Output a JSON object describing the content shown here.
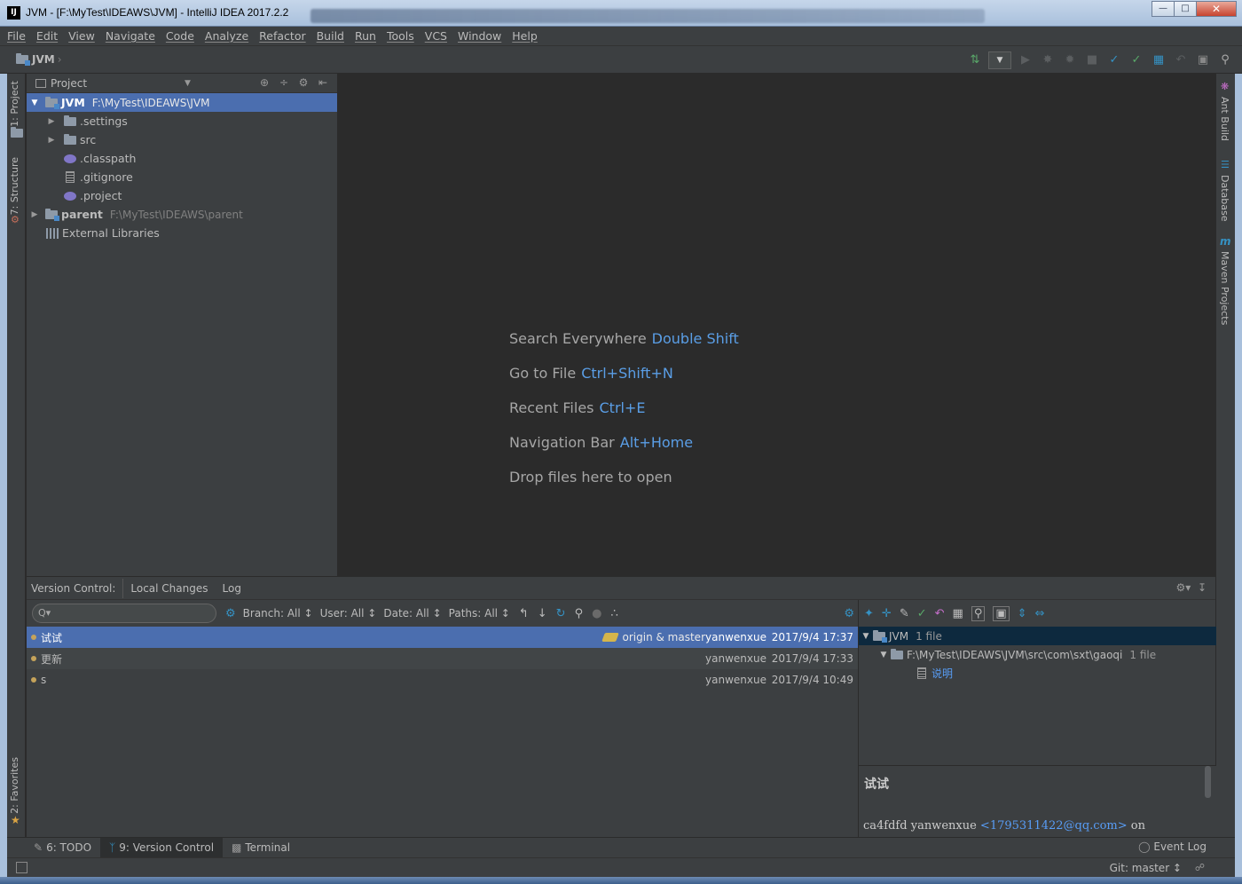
{
  "window": {
    "title": "JVM - [F:\\MyTest\\IDEAWS\\JVM] - IntelliJ IDEA 2017.2.2",
    "app_icon": "IJ",
    "controls": [
      "minimize",
      "maximize",
      "close"
    ]
  },
  "menu": [
    "File",
    "Edit",
    "View",
    "Navigate",
    "Code",
    "Analyze",
    "Refactor",
    "Build",
    "Run",
    "Tools",
    "VCS",
    "Window",
    "Help"
  ],
  "navbar": {
    "breadcrumb": "JVM"
  },
  "left_strip": {
    "tabs": [
      "1: Project",
      "7: Structure",
      "2: Favorites"
    ]
  },
  "right_strip": {
    "tabs": [
      "Ant Build",
      "Database",
      "Maven Projects"
    ]
  },
  "project_panel": {
    "title": "Project",
    "tree": [
      {
        "name": "JVM",
        "path": "F:\\MyTest\\IDEAWS\\JVM",
        "expanded": true,
        "selected": true,
        "icon": "module-folder-icon",
        "depth": 0
      },
      {
        "name": ".settings",
        "icon": "folder-icon",
        "depth": 1,
        "collapsed": true
      },
      {
        "name": "src",
        "icon": "folder-icon",
        "depth": 1,
        "collapsed": true
      },
      {
        "name": ".classpath",
        "icon": "classpath-file-icon",
        "depth": 1
      },
      {
        "name": ".gitignore",
        "icon": "text-file-icon",
        "depth": 1
      },
      {
        "name": ".project",
        "icon": "classpath-file-icon",
        "depth": 1
      },
      {
        "name": "parent",
        "path": "F:\\MyTest\\IDEAWS\\parent",
        "icon": "module-folder-icon",
        "depth": 0,
        "collapsed": true
      },
      {
        "name": "External Libraries",
        "icon": "library-icon",
        "depth": 0
      }
    ]
  },
  "editor": {
    "hints": [
      {
        "label": "Search Everywhere",
        "key": "Double Shift"
      },
      {
        "label": "Go to File",
        "key": "Ctrl+Shift+N"
      },
      {
        "label": "Recent Files",
        "key": "Ctrl+E"
      },
      {
        "label": "Navigation Bar",
        "key": "Alt+Home"
      },
      {
        "label": "Drop files here to open",
        "key": ""
      }
    ]
  },
  "version_control": {
    "title": "Version Control:",
    "tabs": [
      "Local Changes",
      "Log"
    ],
    "active_tab": "Log",
    "search_placeholder": "Q▾",
    "filters": [
      "Branch: All ↕",
      "User: All ↕",
      "Date: All ↕",
      "Paths: All ↕"
    ],
    "commits": [
      {
        "message": "试试",
        "refs": "origin & master",
        "author": "yanwenxue",
        "date": "2017/9/4 17:37",
        "selected": true
      },
      {
        "message": "更新",
        "refs": "",
        "author": "yanwenxue",
        "date": "2017/9/4 17:33"
      },
      {
        "message": "s",
        "refs": "",
        "author": "yanwenxue",
        "date": "2017/9/4 10:49"
      }
    ],
    "changes": {
      "tree": [
        {
          "name": "JVM",
          "count": "1 file",
          "selected": true
        },
        {
          "name": "F:\\MyTest\\IDEAWS\\JVM\\src\\com\\sxt\\gaoqi",
          "count": "1 file"
        },
        {
          "name": "说明"
        }
      ],
      "detail": {
        "subject": "试试",
        "hash": "ca4fdfd",
        "author": "yanwenxue",
        "email": "<1795311422@qq.com>",
        "suffix": "on"
      }
    }
  },
  "bottom_tabs": [
    {
      "label": "6: TODO",
      "icon": "todo-icon"
    },
    {
      "label": "9: Version Control",
      "icon": "vcs-branch-icon",
      "active": true
    },
    {
      "label": "Terminal",
      "icon": "terminal-icon"
    }
  ],
  "event_log": "Event Log",
  "status": {
    "git": "Git: master ↕"
  },
  "colors": {
    "selection": "#4b6eaf",
    "link": "#589df6",
    "background": "#2b2b2b",
    "panel": "#3c3f41"
  }
}
